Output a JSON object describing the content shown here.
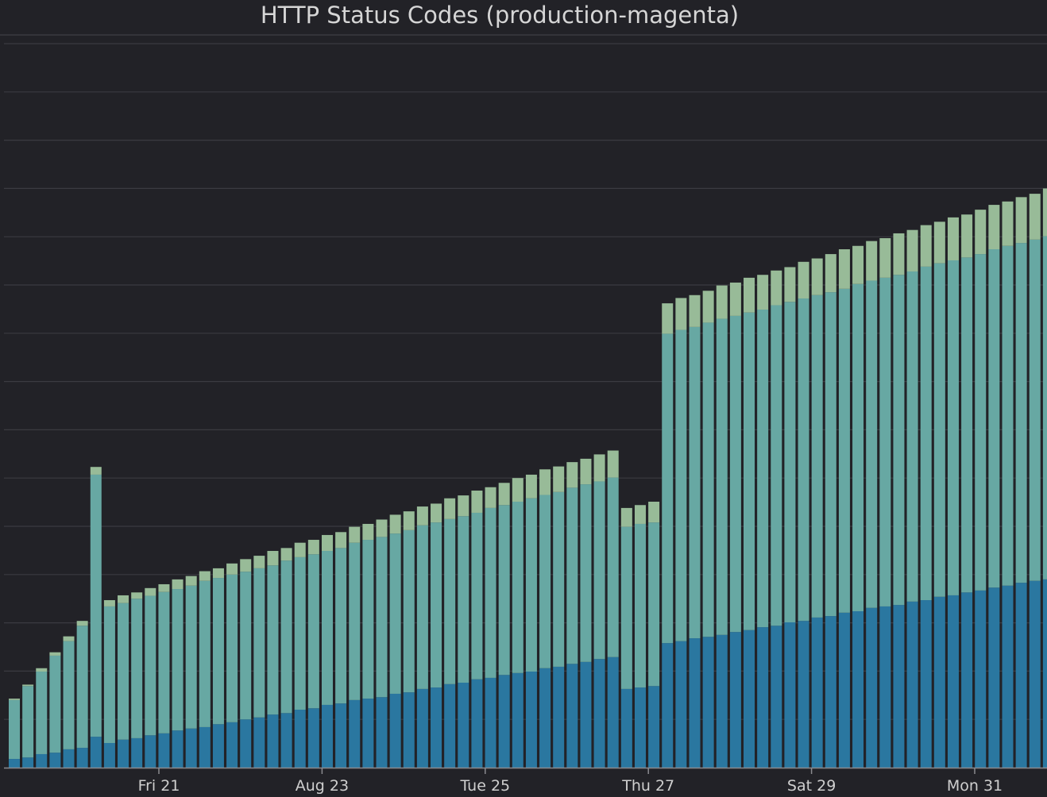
{
  "chart_data": {
    "type": "bar",
    "stacked": true,
    "title": "HTTP Status Codes (production-magenta)",
    "xlabel": "",
    "ylabel": "",
    "x_ticks": [
      "Fri 21",
      "Aug 23",
      "Tue 25",
      "Thu 27",
      "Sat 29",
      "Mon 31"
    ],
    "y_ticks_shown": false,
    "grid": true,
    "ylim": [
      0,
      15
    ],
    "colors": [
      "#2a77a0",
      "#67a8a3",
      "#98bb98"
    ],
    "series": [
      {
        "values": [
          0.18,
          0.21,
          0.28,
          0.31,
          0.38,
          0.41,
          0.64,
          0.51,
          0.58,
          0.61,
          0.67,
          0.71,
          0.77,
          0.81,
          0.84,
          0.9,
          0.94,
          1.0,
          1.04,
          1.1,
          1.13,
          1.2,
          1.23,
          1.3,
          1.33,
          1.4,
          1.43,
          1.46,
          1.53,
          1.56,
          1.63,
          1.66,
          1.73,
          1.76,
          1.83,
          1.86,
          1.92,
          1.96,
          1.99,
          2.06,
          2.09,
          2.15,
          2.19,
          2.25,
          2.29,
          1.63,
          1.66,
          1.69,
          2.58,
          2.62,
          2.68,
          2.71,
          2.75,
          2.81,
          2.85,
          2.91,
          2.94,
          3.01,
          3.04,
          3.11,
          3.14,
          3.21,
          3.24,
          3.31,
          3.34,
          3.37,
          3.44,
          3.47,
          3.54,
          3.57,
          3.63,
          3.67,
          3.73,
          3.77,
          3.83,
          3.87,
          3.9
        ]
      },
      {
        "values": [
          1.22,
          1.48,
          1.71,
          2.01,
          2.24,
          2.53,
          5.43,
          2.83,
          2.83,
          2.89,
          2.89,
          2.93,
          2.93,
          2.96,
          3.03,
          3.03,
          3.06,
          3.06,
          3.09,
          3.09,
          3.16,
          3.16,
          3.19,
          3.19,
          3.22,
          3.26,
          3.29,
          3.32,
          3.32,
          3.36,
          3.39,
          3.42,
          3.42,
          3.45,
          3.45,
          3.52,
          3.52,
          3.55,
          3.59,
          3.59,
          3.62,
          3.65,
          3.68,
          3.68,
          3.72,
          3.36,
          3.39,
          3.39,
          6.41,
          6.45,
          6.45,
          6.51,
          6.55,
          6.55,
          6.58,
          6.58,
          6.64,
          6.64,
          6.68,
          6.68,
          6.71,
          6.71,
          6.78,
          6.78,
          6.81,
          6.84,
          6.84,
          6.91,
          6.91,
          6.94,
          6.94,
          6.97,
          7.01,
          7.04,
          7.04,
          7.07,
          7.11
        ]
      },
      {
        "values": [
          0.03,
          0.03,
          0.07,
          0.07,
          0.1,
          0.1,
          0.16,
          0.13,
          0.16,
          0.13,
          0.16,
          0.16,
          0.2,
          0.2,
          0.2,
          0.2,
          0.23,
          0.26,
          0.26,
          0.3,
          0.26,
          0.3,
          0.3,
          0.33,
          0.33,
          0.33,
          0.33,
          0.36,
          0.39,
          0.39,
          0.39,
          0.39,
          0.43,
          0.43,
          0.46,
          0.43,
          0.46,
          0.49,
          0.49,
          0.53,
          0.53,
          0.53,
          0.53,
          0.56,
          0.56,
          0.39,
          0.39,
          0.43,
          0.63,
          0.66,
          0.66,
          0.66,
          0.69,
          0.69,
          0.72,
          0.72,
          0.72,
          0.72,
          0.76,
          0.76,
          0.79,
          0.82,
          0.79,
          0.82,
          0.82,
          0.86,
          0.86,
          0.86,
          0.86,
          0.89,
          0.89,
          0.92,
          0.92,
          0.92,
          0.95,
          0.95,
          0.99
        ]
      }
    ]
  }
}
